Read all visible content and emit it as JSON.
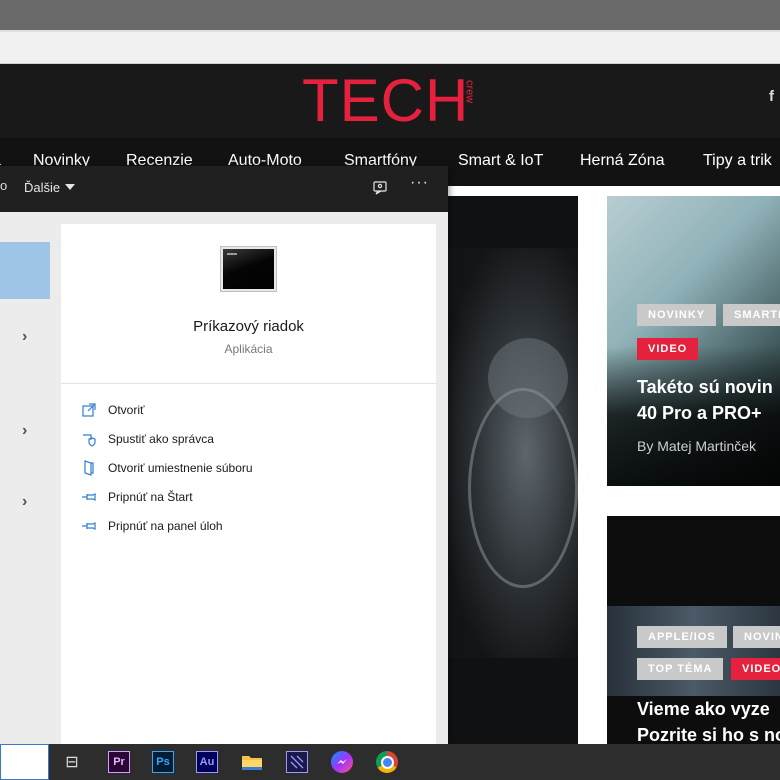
{
  "site": {
    "logo": "TECH",
    "logo_sub": "crew",
    "nav_items": [
      "a",
      "Novinky",
      "Recenzie",
      "Auto-Moto",
      "Smartfóny",
      "Smart & IoT",
      "Herná Zóna",
      "Tipy a trik"
    ],
    "cards": [
      {
        "tags_row1": [
          "NOVINKY",
          "SMARTF"
        ],
        "tags_row2": [
          "VIDEO"
        ],
        "title_lines": [
          "Takéto sú novin",
          "40 Pro a PRO+"
        ],
        "author": "By Matej Martinček"
      },
      {
        "tags_row1": [
          "APPLE/IOS",
          "NOVIN"
        ],
        "tags_row2": [
          "TOP TÉMA",
          "VIDEO"
        ],
        "title_lines": [
          "Vieme ako vyze",
          "Pozrite si ho s no"
        ]
      }
    ]
  },
  "panel": {
    "left_edge_text": "o",
    "more_label": "Ďalšie",
    "app_name": "Príkazový riadok",
    "app_type": "Aplikácia",
    "actions": [
      {
        "label": "Otvoriť",
        "icon": "open-icon"
      },
      {
        "label": "Spustiť ako správca",
        "icon": "shield-icon"
      },
      {
        "label": "Otvoriť umiestnenie súboru",
        "icon": "file-location-icon"
      },
      {
        "label": "Pripnúť na Štart",
        "icon": "pin-icon"
      },
      {
        "label": "Pripnúť na panel úloh",
        "icon": "pin-icon"
      }
    ]
  },
  "taskbar": {
    "apps": [
      "task-view",
      "Pr",
      "Ps",
      "Au",
      "file-explorer",
      "after-effects",
      "messenger",
      "chrome"
    ]
  },
  "colors": {
    "brand_red": "#e5213d",
    "selection_blue": "#9ec4e6",
    "action_icon_blue": "#2f7fd0"
  }
}
